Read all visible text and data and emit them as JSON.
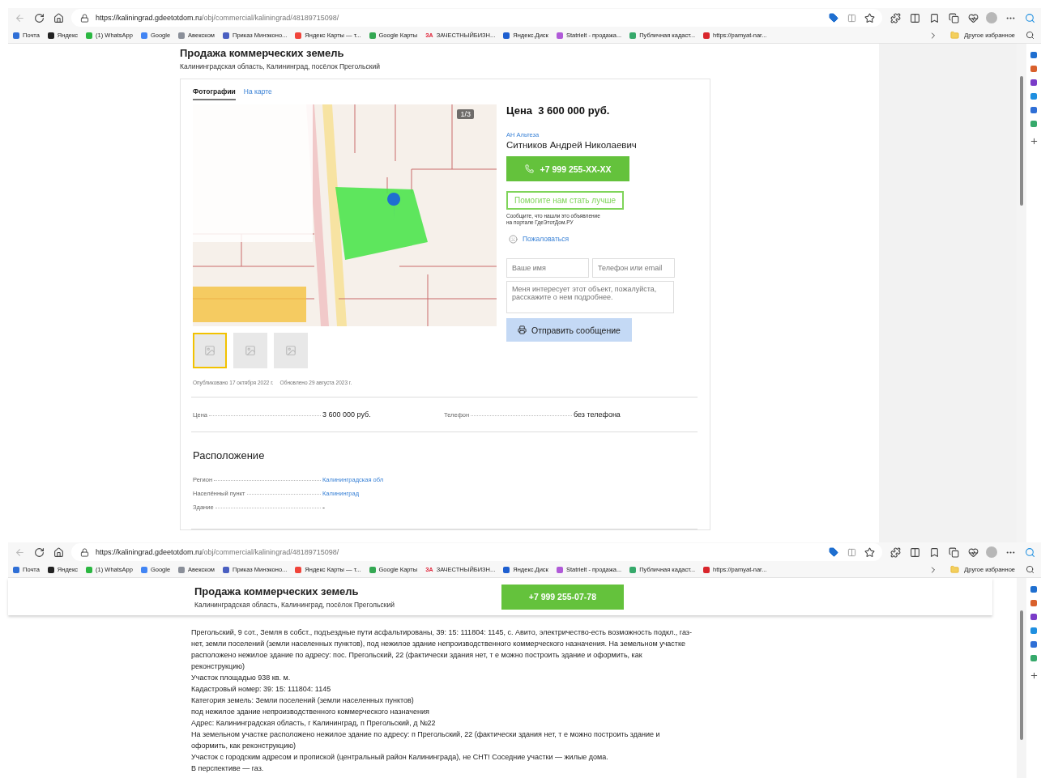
{
  "browsers": [
    {
      "url_host": "https://kaliningrad.gdeetotdom.ru",
      "url_path": "/obj/commercial/kaliningrad/48189715098/",
      "bookmarks": [
        {
          "label": "Почта",
          "color": "#2f6fd6"
        },
        {
          "label": "Яндекс",
          "color": "#222222"
        },
        {
          "label": "(1) WhatsApp",
          "color": "#2bb741"
        },
        {
          "label": "Google",
          "color": "#4285f4"
        },
        {
          "label": "Авекском",
          "color": "#8a8f99"
        },
        {
          "label": "Приказ Минэконо...",
          "color": "#4a5fc1"
        },
        {
          "label": "Яндекс Карты — т...",
          "color": "#f0443a"
        },
        {
          "label": "Google Карты",
          "color": "#34a853"
        },
        {
          "label": "ЗАЧЕСТНЫЙБИЗН...",
          "badge": "ЗА",
          "color": "#e0263b"
        },
        {
          "label": "Яндекс.Диск",
          "color": "#1e5fd0"
        },
        {
          "label": "Statrielt - продажа...",
          "color": "#b05ad8"
        },
        {
          "label": "Публичная кадаст...",
          "color": "#36a96b"
        },
        {
          "label": "https://pamyat-nar...",
          "color": "#d9262c"
        }
      ],
      "other_bookmarks": "Другое избранное"
    },
    {
      "url_host": "https://kaliningrad.gdeetotdom.ru",
      "url_path": "/obj/commercial/kaliningrad/48189715098/",
      "bookmarks": [
        {
          "label": "Почта",
          "color": "#2f6fd6"
        },
        {
          "label": "Яндекс",
          "color": "#222222"
        },
        {
          "label": "(1) WhatsApp",
          "color": "#2bb741"
        },
        {
          "label": "Google",
          "color": "#4285f4"
        },
        {
          "label": "Авекском",
          "color": "#8a8f99"
        },
        {
          "label": "Приказ Минэконо...",
          "color": "#4a5fc1"
        },
        {
          "label": "Яндекс Карты — т...",
          "color": "#f0443a"
        },
        {
          "label": "Google Карты",
          "color": "#34a853"
        },
        {
          "label": "ЗАЧЕСТНЫЙБИЗН...",
          "badge": "ЗА",
          "color": "#e0263b"
        },
        {
          "label": "Яндекс.Диск",
          "color": "#1e5fd0"
        },
        {
          "label": "Statrielt - продажа...",
          "color": "#b05ad8"
        },
        {
          "label": "Публичная кадаст...",
          "color": "#36a96b"
        },
        {
          "label": "https://pamyat-nar...",
          "color": "#d9262c"
        }
      ],
      "other_bookmarks": "Другое избранное"
    }
  ],
  "listing": {
    "title": "Продажа коммерческих земель",
    "address": "Калининградская область, Калининград, посёлок Прегольский",
    "tabs": [
      {
        "label": "Фотографии",
        "selected": true
      },
      {
        "label": "На карте",
        "selected": false
      }
    ],
    "gallery": {
      "counter": "1/3",
      "thumbnails": [
        {
          "selected": true
        },
        {
          "selected": false
        },
        {
          "selected": false
        }
      ]
    },
    "price_heading": "Цена  3 600 000 руб.",
    "agency": "АН Альтеза",
    "agent": "Ситников Андрей Николаевич",
    "phone": "+7 999 255-XX-XX",
    "feedback_button": "Помогите нам стать лучше",
    "feedback_note": [
      "Сообщите, что нашли это объявление",
      "на портале ГдеЭтотДом.РУ"
    ],
    "complain": "Пожаловаться",
    "name_placeholder": "Ваше имя",
    "contact_placeholder": "Телефон или email",
    "message_placeholder": "Меня интересует этот объект, пожалуйста, расскажите о нем подробнее.",
    "send_button": "Отправить сообщение",
    "published": "Опубликовано 17 октября 2022 г.",
    "updated": "Обновлено 29 августа 2023 г.",
    "facts": [
      {
        "label": "Цена",
        "value": "3 600 000 руб."
      },
      {
        "label": "Телефон",
        "value": "без телефона"
      }
    ],
    "location_heading": "Расположение",
    "location": [
      {
        "label": "Регион",
        "value": "Калининградская обл",
        "link": true
      },
      {
        "label": "Населённый пункт",
        "value": "Калининград",
        "link": true
      },
      {
        "label": "Здание",
        "value": "-",
        "link": false
      }
    ]
  },
  "sticky": {
    "title": "Продажа коммерческих земель",
    "address": "Калининградская область, Калининград, посёлок Прегольский",
    "phone": "+7 999 255-07-78"
  },
  "description": [
    "Прегольский, 9 сот., Земля в собст., подъездные пути асфальтированы, 39: 15: 111804: 1145, с. Авито, электричество-есть возможность подкл., газ-нет, земли поселений (земли населенных пунктов), под нежилое здание непроизводственного коммерческого назначения. На земельном участке расположено нежилое здание по адресу: пос. Прегольский, 22 (фактически здания нет, т е можно построить здание и оформить, как реконструкцию)",
    "Участок площадью 938 кв. м.",
    "Кадастровый номер: 39: 15: 111804: 1145",
    "Категория земель: Земли поселений (земли населенных пунктов)",
    "под нежилое здание непроизводственного коммерческого назначения",
    "Адрес: Калининградская область, г Калининград, п Прегольский, д №22",
    "На земельном участке расположено нежилое здание по адресу: п Прегольский, 22 (фактически здания нет, т е можно построить здание и оформить, как реконструкцию)",
    "Участок с городским адресом и пропиской (центральный район Калининграда), не СНТ! Соседние участки — жилые дома.",
    "В перспективе — газ."
  ]
}
